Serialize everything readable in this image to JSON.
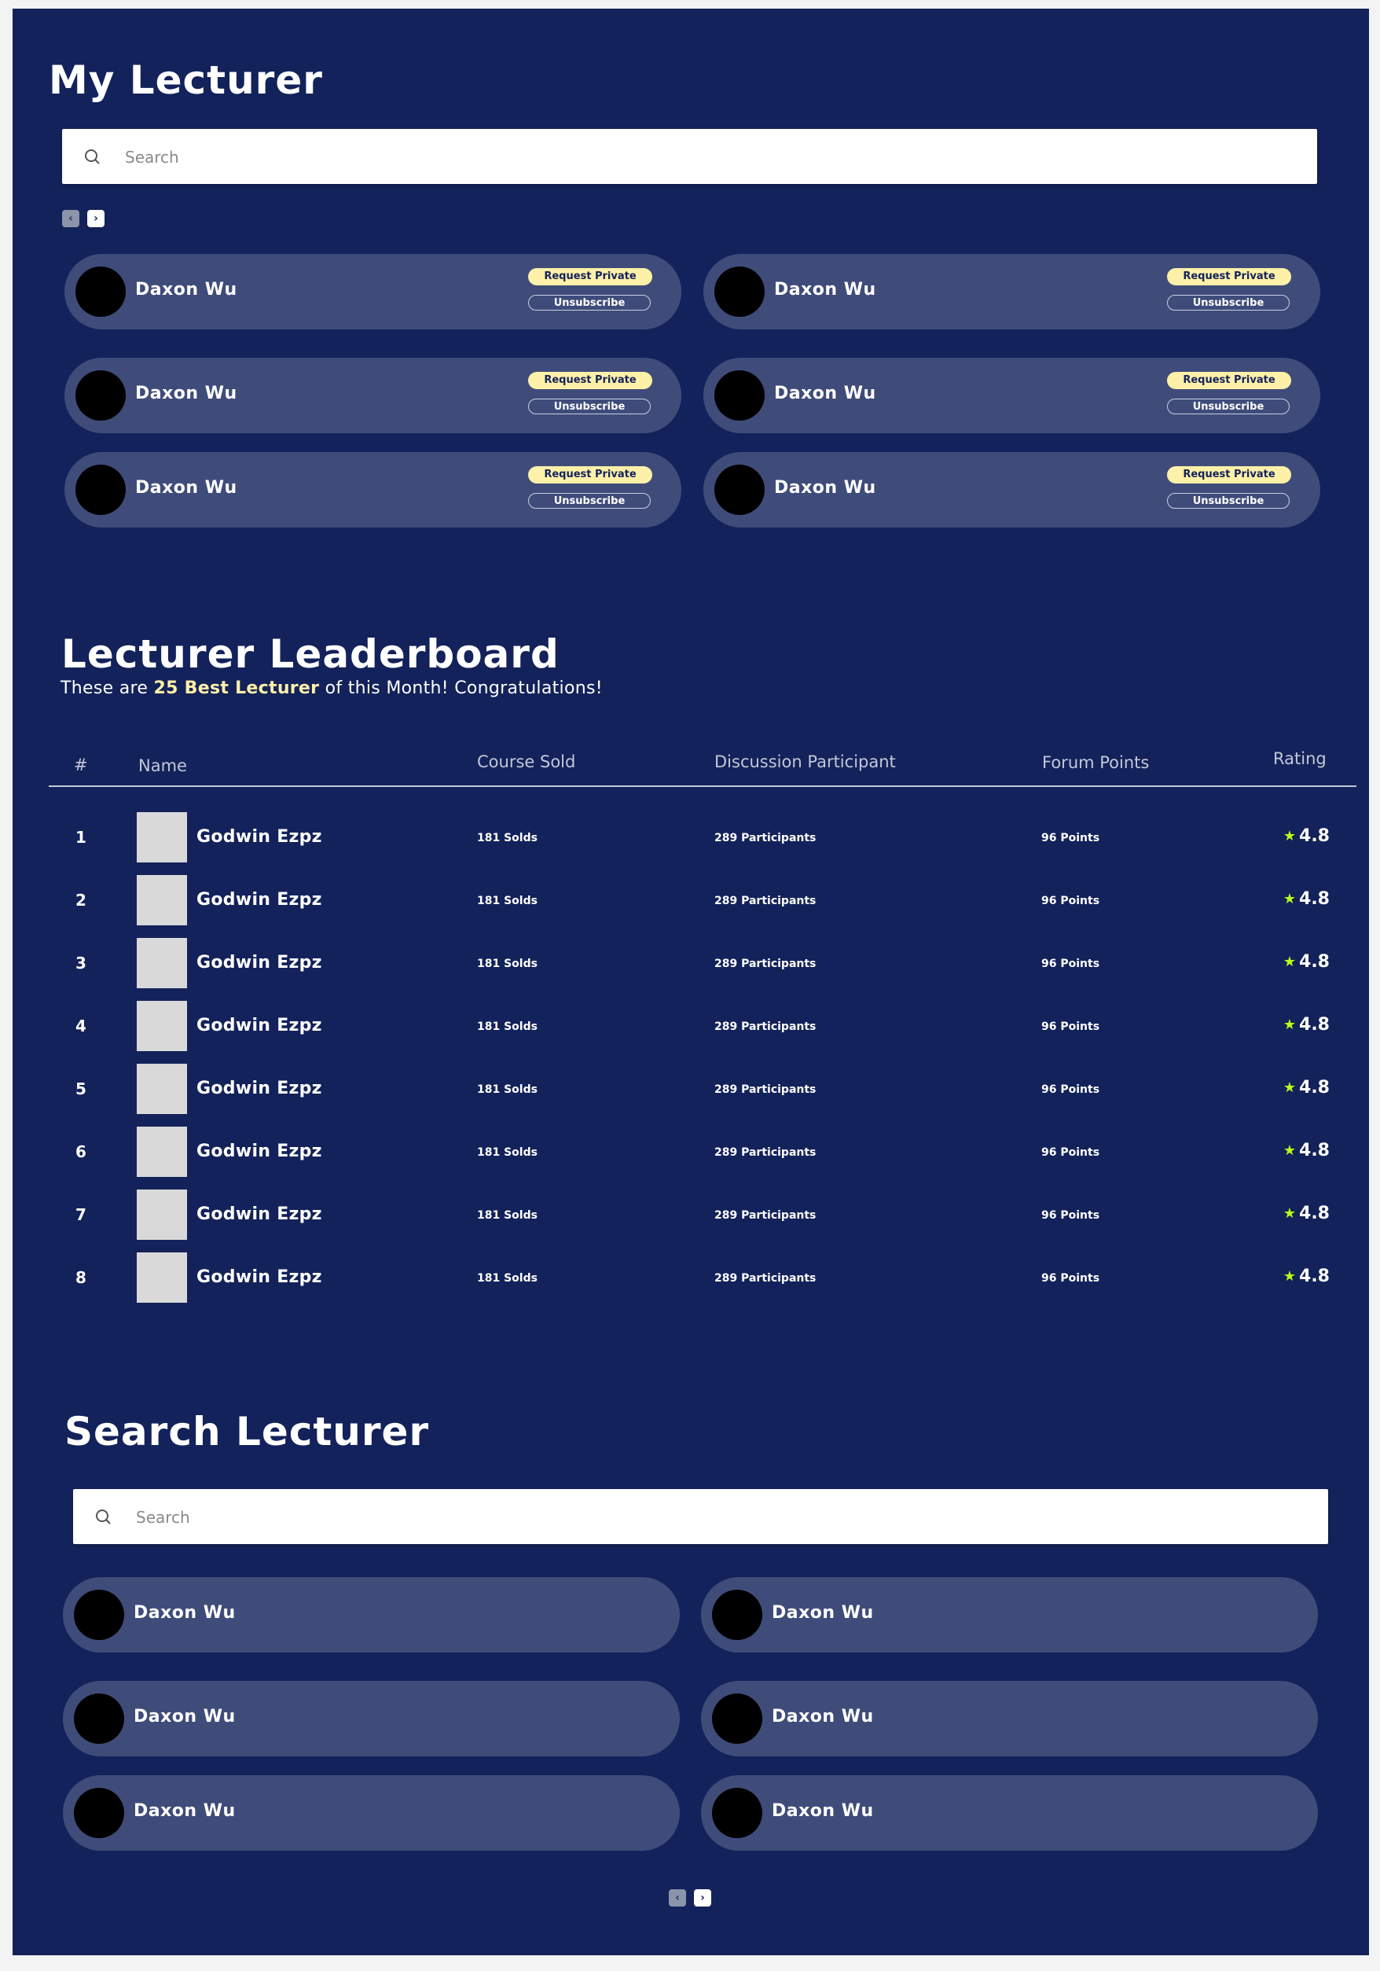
{
  "my_lecturer": {
    "title": "My Lecturer",
    "search_placeholder": "Search",
    "pager": {
      "prev": "‹",
      "next": "›"
    },
    "cards": [
      {
        "name": "Daxon Wu",
        "request_label": "Request Private",
        "unsubscribe_label": "Unsubscribe"
      },
      {
        "name": "Daxon Wu",
        "request_label": "Request Private",
        "unsubscribe_label": "Unsubscribe"
      },
      {
        "name": "Daxon Wu",
        "request_label": "Request Private",
        "unsubscribe_label": "Unsubscribe"
      },
      {
        "name": "Daxon Wu",
        "request_label": "Request Private",
        "unsubscribe_label": "Unsubscribe"
      },
      {
        "name": "Daxon Wu",
        "request_label": "Request Private",
        "unsubscribe_label": "Unsubscribe"
      },
      {
        "name": "Daxon Wu",
        "request_label": "Request Private",
        "unsubscribe_label": "Unsubscribe"
      }
    ]
  },
  "leaderboard": {
    "title": "Lecturer Leaderboard",
    "subtitle_pre": "These are ",
    "subtitle_highlight": "25 Best Lecturer",
    "subtitle_post": " of this Month! Congratulations!",
    "columns": {
      "rank": "#",
      "name": "Name",
      "course_sold": "Course Sold",
      "discussion": "Discussion Participant",
      "forum": "Forum Points",
      "rating": "Rating"
    },
    "rows": [
      {
        "rank": "1",
        "name": "Godwin Ezpz",
        "sold": "181 Solds",
        "participants": "289 Participants",
        "points": "96 Points",
        "rating": "4.8"
      },
      {
        "rank": "2",
        "name": "Godwin Ezpz",
        "sold": "181 Solds",
        "participants": "289 Participants",
        "points": "96 Points",
        "rating": "4.8"
      },
      {
        "rank": "3",
        "name": "Godwin Ezpz",
        "sold": "181 Solds",
        "participants": "289 Participants",
        "points": "96 Points",
        "rating": "4.8"
      },
      {
        "rank": "4",
        "name": "Godwin Ezpz",
        "sold": "181 Solds",
        "participants": "289 Participants",
        "points": "96 Points",
        "rating": "4.8"
      },
      {
        "rank": "5",
        "name": "Godwin Ezpz",
        "sold": "181 Solds",
        "participants": "289 Participants",
        "points": "96 Points",
        "rating": "4.8"
      },
      {
        "rank": "6",
        "name": "Godwin Ezpz",
        "sold": "181 Solds",
        "participants": "289 Participants",
        "points": "96 Points",
        "rating": "4.8"
      },
      {
        "rank": "7",
        "name": "Godwin Ezpz",
        "sold": "181 Solds",
        "participants": "289 Participants",
        "points": "96 Points",
        "rating": "4.8"
      },
      {
        "rank": "8",
        "name": "Godwin Ezpz",
        "sold": "181 Solds",
        "participants": "289 Participants",
        "points": "96 Points",
        "rating": "4.8"
      }
    ]
  },
  "search_lecturer": {
    "title": "Search Lecturer",
    "search_placeholder": "Search",
    "pager": {
      "prev": "‹",
      "next": "›"
    },
    "cards": [
      {
        "name": "Daxon Wu"
      },
      {
        "name": "Daxon Wu"
      },
      {
        "name": "Daxon Wu"
      },
      {
        "name": "Daxon Wu"
      },
      {
        "name": "Daxon Wu"
      },
      {
        "name": "Daxon Wu"
      }
    ]
  },
  "icons": {
    "search": "search-icon",
    "star": "star-icon",
    "prev": "chevron-left-icon",
    "next": "chevron-right-icon"
  },
  "colors": {
    "background": "#13225a",
    "card": "#3f4c7a",
    "accent": "#fdf0a8",
    "star": "#b7ff1a"
  }
}
